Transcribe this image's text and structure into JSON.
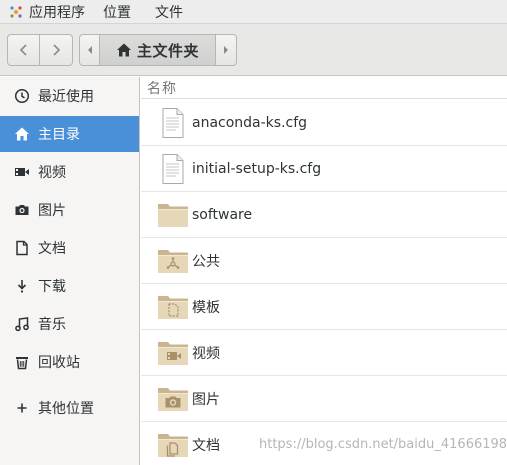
{
  "topbar": {
    "app_menu": "应用程序",
    "places_menu": "位置",
    "file_menu": "文件"
  },
  "toolbar": {
    "path_current": "主文件夹"
  },
  "sidebar": {
    "items": [
      {
        "label": "最近使用",
        "icon": "clock-icon"
      },
      {
        "label": "主目录",
        "icon": "home-icon",
        "active": true
      },
      {
        "label": "视频",
        "icon": "video-icon"
      },
      {
        "label": "图片",
        "icon": "camera-icon"
      },
      {
        "label": "文档",
        "icon": "document-icon"
      },
      {
        "label": "下载",
        "icon": "download-icon"
      },
      {
        "label": "音乐",
        "icon": "music-icon"
      },
      {
        "label": "回收站",
        "icon": "trash-icon"
      },
      {
        "label": "其他位置",
        "icon": "plus-icon"
      }
    ]
  },
  "main": {
    "column_name": "名称",
    "files": [
      {
        "name": "anaconda-ks.cfg",
        "icon": "text-file-icon"
      },
      {
        "name": "initial-setup-ks.cfg",
        "icon": "text-file-icon"
      },
      {
        "name": "software",
        "icon": "folder-icon"
      },
      {
        "name": "公共",
        "icon": "folder-public-icon"
      },
      {
        "name": "模板",
        "icon": "folder-templates-icon"
      },
      {
        "name": "视频",
        "icon": "folder-videos-icon"
      },
      {
        "name": "图片",
        "icon": "folder-pictures-icon"
      },
      {
        "name": "文档",
        "icon": "folder-documents-icon"
      }
    ]
  },
  "watermark": "https://blog.csdn.net/baidu_41666198",
  "colors": {
    "accent": "#4a90d9",
    "folder": "#d9c9a8"
  }
}
